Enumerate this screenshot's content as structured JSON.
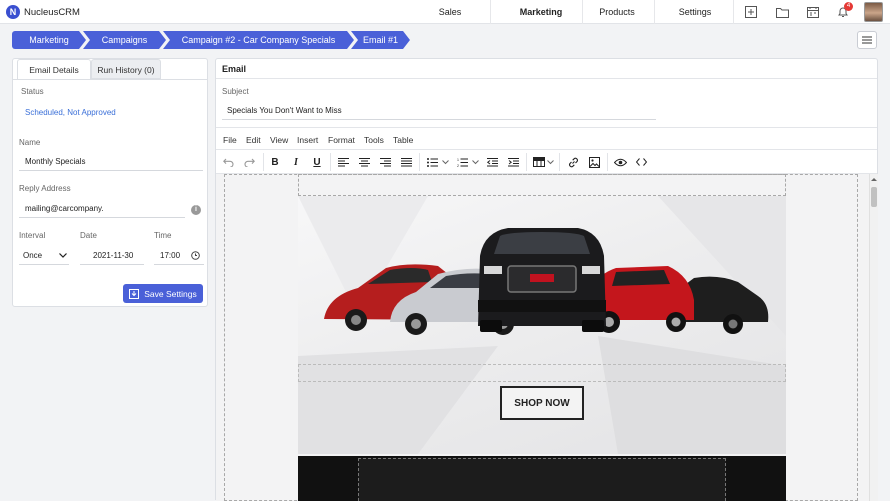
{
  "app": {
    "logo_letter": "N",
    "name": "NucleusCRM"
  },
  "nav": {
    "items": [
      "Sales",
      "Marketing",
      "Products",
      "Settings"
    ]
  },
  "notifications": {
    "count": "4"
  },
  "breadcrumb": [
    "Marketing",
    "Campaigns",
    "Campaign #2 - Car Company Specials",
    "Email #1"
  ],
  "tabs": {
    "details": "Email Details",
    "history": "Run History (0)"
  },
  "details": {
    "status_label": "Status",
    "status_value": "Scheduled, Not Approved",
    "name_label": "Name",
    "name_value": "Monthly Specials",
    "reply_label": "Reply Address",
    "reply_value": "mailing@carcompany.",
    "interval_label": "Interval",
    "interval_value": "Once",
    "date_label": "Date",
    "date_value": "2021-11-30",
    "time_label": "Time",
    "time_value": "17:00",
    "save_label": "Save Settings"
  },
  "email": {
    "title": "Email",
    "subject_label": "Subject",
    "subject_value": "Specials You Don't Want to Miss",
    "menu": [
      "File",
      "Edit",
      "View",
      "Insert",
      "Format",
      "Tools",
      "Table"
    ],
    "shop_label": "SHOP NOW"
  },
  "colors": {
    "accent": "#4a60d8",
    "status": "#3a6fd8",
    "alert": "#e53935"
  }
}
